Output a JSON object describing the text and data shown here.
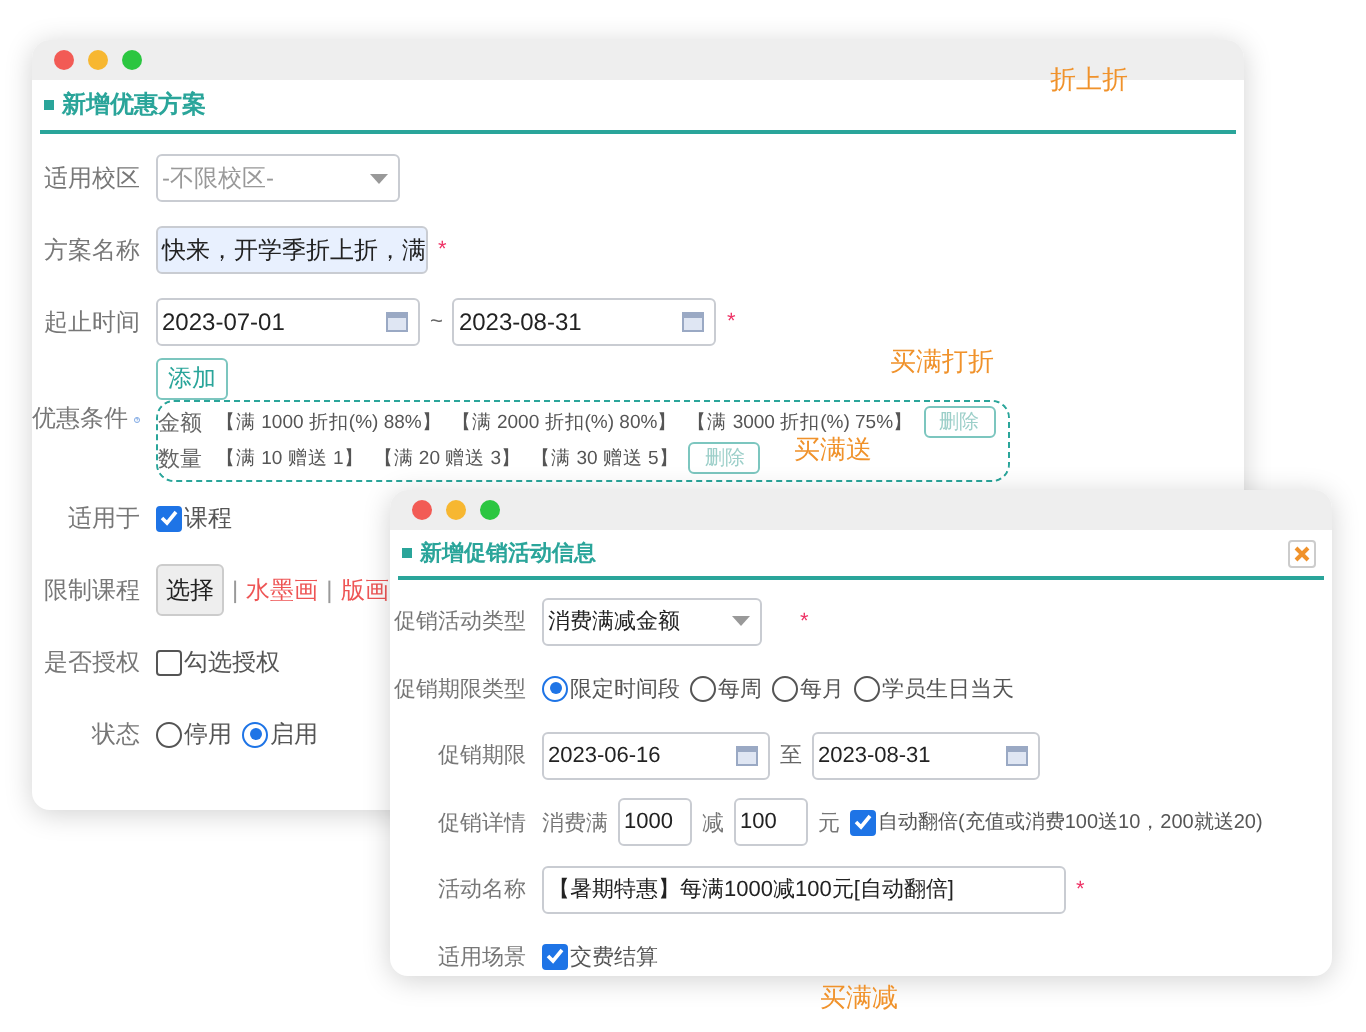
{
  "main_window": {
    "title": "新增优惠方案",
    "rows": [
      {
        "kind": "select",
        "label": "适用校区",
        "placeholder": "-不限校区-"
      },
      {
        "kind": "text",
        "label": "方案名称",
        "value": "快来，开学季折上折，满",
        "required_mark": "*"
      },
      {
        "kind": "daterange",
        "label": "起止时间",
        "from": "2023-07-01",
        "separator": "~",
        "to": "2023-08-31",
        "required_mark": "*"
      },
      {
        "kind": "conditions",
        "label": "优惠条件",
        "add_button": "添加",
        "groups": [
          {
            "label": "金额",
            "items": [
              "【满 1000 折扣(%) 88%】",
              "【满 2000 折扣(%) 80%】",
              "【满 3000 折扣(%) 75%】"
            ],
            "delete_button": "删除"
          },
          {
            "label": "数量",
            "items": [
              "【满 10 赠送 1】",
              "【满 20 赠送 3】",
              "【满 30 赠送 5】"
            ],
            "delete_button": "删除"
          }
        ]
      },
      {
        "kind": "checks",
        "label": "适用于",
        "options": [
          {
            "label": "课程",
            "checked": true
          }
        ]
      },
      {
        "kind": "picker",
        "label": "限制课程",
        "button": "选择",
        "separator": "|",
        "items": [
          "水墨画",
          "版画"
        ]
      },
      {
        "kind": "checks",
        "label": "是否授权",
        "options": [
          {
            "label": "勾选授权",
            "checked": false
          }
        ]
      },
      {
        "kind": "radios",
        "label": "状态",
        "options": [
          {
            "label": "停用",
            "selected": false
          },
          {
            "label": "启用",
            "selected": true
          }
        ]
      }
    ]
  },
  "dialog": {
    "title": "新增促销活动信息",
    "rows": [
      {
        "kind": "select",
        "label": "促销活动类型",
        "value": "消费满减金额",
        "required_mark": "*"
      },
      {
        "kind": "radios",
        "label": "促销期限类型",
        "options": [
          {
            "label": "限定时间段",
            "selected": true
          },
          {
            "label": "每周",
            "selected": false
          },
          {
            "label": "每月",
            "selected": false
          },
          {
            "label": "学员生日当天",
            "selected": false
          }
        ]
      },
      {
        "kind": "daterange",
        "label": "促销期限",
        "from": "2023-06-16",
        "separator": "至",
        "to": "2023-08-31"
      },
      {
        "kind": "detail",
        "label": "促销详情",
        "prefix": "消费满",
        "amount": "1000",
        "middle": "减",
        "discount": "100",
        "unit": "元",
        "option": {
          "label": "自动翻倍(充值或消费100送10，200就送20)",
          "checked": true
        }
      },
      {
        "kind": "text",
        "label": "活动名称",
        "value": "【暑期特惠】每满1000减100元[自动翻倍]",
        "required_mark": "*"
      },
      {
        "kind": "checks",
        "label": "适用场景",
        "options": [
          {
            "label": "交费结算",
            "checked": true
          }
        ]
      }
    ]
  },
  "captions": [
    "折上折",
    "买满打折",
    "买满送",
    "买满减"
  ]
}
